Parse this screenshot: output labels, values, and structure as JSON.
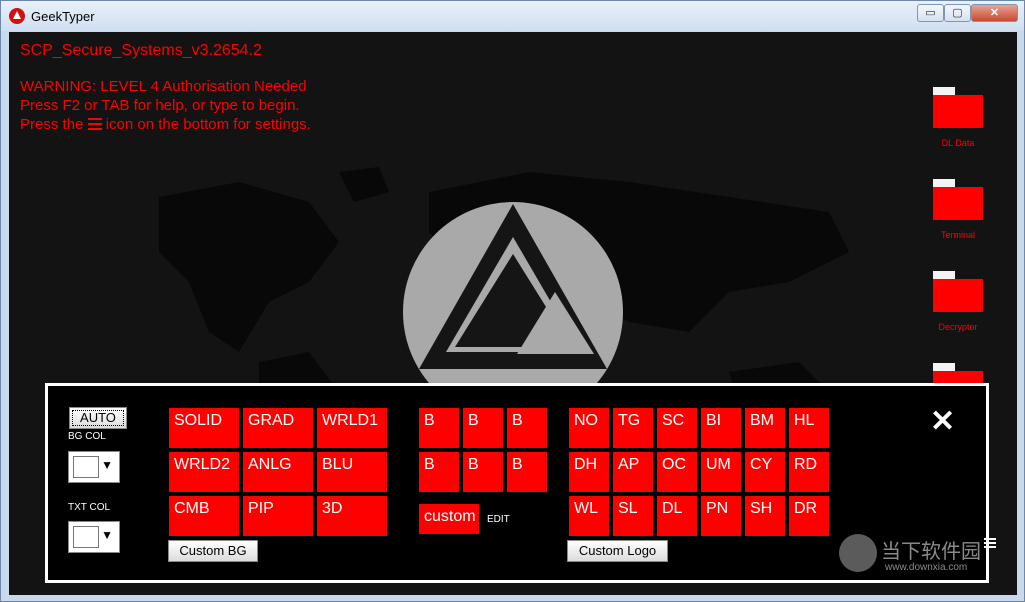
{
  "window": {
    "title": "GeekTyper",
    "min_glyph": "▭",
    "max_glyph": "▢",
    "close_glyph": "✕"
  },
  "screen": {
    "system_title": "SCP_Secure_Systems_v3.2654.2",
    "warning_line1": "WARNING: LEVEL 4 Authorisation Needed",
    "warning_line2": "Press F2 or TAB for help, or type to begin.",
    "warning_line3_pre": "Press the",
    "warning_line3_post": "icon on the bottom for settings.",
    "accent_color": "#ff0000"
  },
  "folders": [
    {
      "label": "DL Data"
    },
    {
      "label": "Terminal"
    },
    {
      "label": "Decryptor"
    },
    {
      "label": ""
    }
  ],
  "panel": {
    "auto_label": "AUTO",
    "bg_col_label": "BG COL",
    "txt_col_label": "TXT COL",
    "dropdown_arrow": "▼",
    "bg_buttons": [
      "SOLID",
      "GRAD",
      "WRLD1",
      "WRLD2",
      "ANLG",
      "BLU",
      "CMB",
      "PIP",
      "3D"
    ],
    "custom_bg_label": "Custom BG",
    "b_buttons": [
      "B",
      "B",
      "B",
      "B",
      "B",
      "B"
    ],
    "custom_label": "custom",
    "edit_label": "EDIT",
    "logo_buttons": [
      "NO",
      "TG",
      "SC",
      "BI",
      "BM",
      "HL",
      "DH",
      "AP",
      "OC",
      "UM",
      "CY",
      "RD",
      "WL",
      "SL",
      "DL",
      "PN",
      "SH",
      "DR"
    ],
    "custom_logo_label": "Custom Logo",
    "close_glyph": "✕"
  },
  "watermark": {
    "text": "当下软件园",
    "url": "www.downxia.com"
  }
}
